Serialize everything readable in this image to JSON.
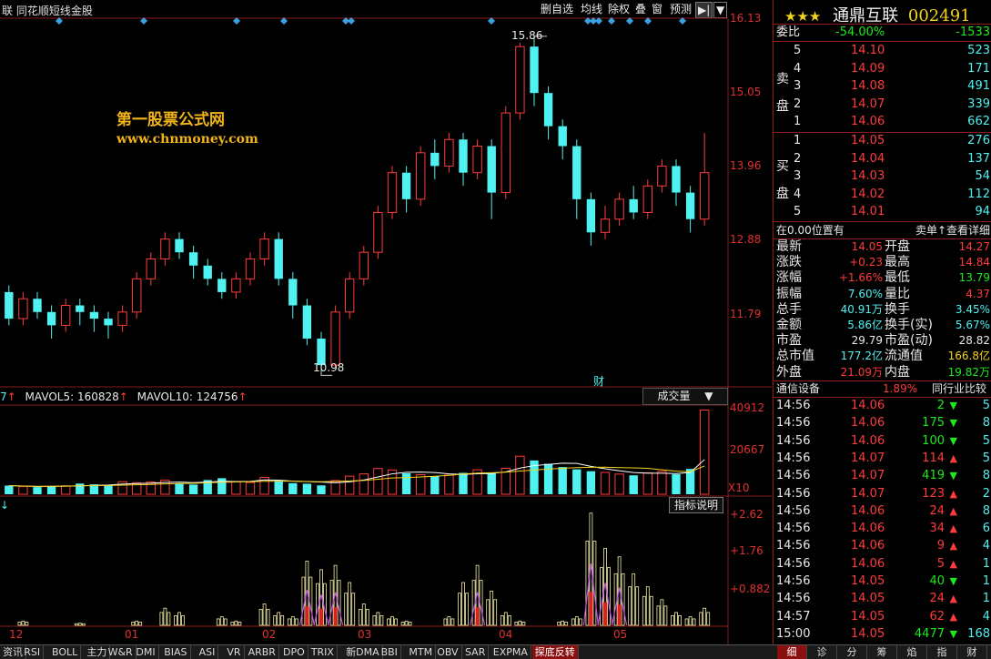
{
  "window": {
    "title": "联 同花顺短线金股"
  },
  "toolbar": {
    "buttons": [
      "删自选",
      "均线",
      "除权",
      "叠",
      "窗",
      "预测"
    ],
    "nav": "▶|",
    "menu": "▼"
  },
  "price_axis": {
    "labels": [
      "16.13",
      "15.05",
      "13.96",
      "12.88",
      "11.79"
    ]
  },
  "annotations": {
    "high": "15.86",
    "low": "10.98",
    "cai": "财"
  },
  "watermark": {
    "line1": "第一股票公式网",
    "line2": "www.chnmoney.com"
  },
  "volume": {
    "prefix": "7",
    "mavol5": "MAVOL5: 160828",
    "mavol10": "MAVOL10: 124756",
    "selector": "成交量",
    "axis": [
      "40912",
      "20667"
    ],
    "unit": "X10"
  },
  "indicator": {
    "button": "指标说明",
    "axis": [
      "+2.62",
      "+1.76",
      "+0.882"
    ]
  },
  "time_axis": {
    "labels": [
      "12",
      "01",
      "02",
      "03",
      "04",
      "05"
    ]
  },
  "chart_data": {
    "type": "candlestick",
    "price": {
      "ylim": [
        10.7,
        16.2
      ],
      "candles": [
        [
          12.1,
          11.7,
          12.2,
          11.6
        ],
        [
          11.7,
          12.0,
          12.1,
          11.6
        ],
        [
          12.0,
          11.8,
          12.1,
          11.7
        ],
        [
          11.8,
          11.6,
          11.9,
          11.4
        ],
        [
          11.6,
          11.9,
          12.0,
          11.5
        ],
        [
          11.9,
          11.8,
          12.0,
          11.6
        ],
        [
          11.8,
          11.7,
          11.9,
          11.5
        ],
        [
          11.7,
          11.6,
          11.8,
          11.4
        ],
        [
          11.6,
          11.8,
          11.9,
          11.5
        ],
        [
          11.8,
          12.3,
          12.4,
          11.7
        ],
        [
          12.3,
          12.6,
          12.7,
          12.2
        ],
        [
          12.6,
          12.9,
          13.0,
          12.5
        ],
        [
          12.9,
          12.7,
          13.0,
          12.6
        ],
        [
          12.7,
          12.5,
          12.8,
          12.3
        ],
        [
          12.5,
          12.3,
          12.6,
          12.2
        ],
        [
          12.3,
          12.1,
          12.4,
          12.0
        ],
        [
          12.1,
          12.3,
          12.4,
          12.0
        ],
        [
          12.3,
          12.6,
          12.7,
          12.2
        ],
        [
          12.6,
          12.9,
          13.0,
          12.5
        ],
        [
          12.9,
          12.3,
          13.0,
          12.2
        ],
        [
          12.3,
          11.9,
          12.4,
          11.7
        ],
        [
          11.9,
          11.4,
          12.0,
          11.3
        ],
        [
          11.4,
          11.0,
          11.5,
          10.9
        ],
        [
          11.0,
          11.8,
          11.9,
          10.98
        ],
        [
          11.8,
          12.3,
          12.4,
          11.7
        ],
        [
          12.3,
          12.7,
          12.8,
          12.2
        ],
        [
          12.7,
          13.3,
          13.4,
          12.6
        ],
        [
          13.3,
          13.9,
          14.0,
          13.2
        ],
        [
          13.9,
          13.5,
          14.0,
          13.3
        ],
        [
          13.5,
          14.2,
          14.3,
          13.4
        ],
        [
          14.2,
          14.0,
          14.4,
          13.8
        ],
        [
          14.0,
          14.4,
          14.5,
          13.9
        ],
        [
          14.4,
          13.9,
          14.5,
          13.7
        ],
        [
          13.9,
          14.3,
          14.4,
          13.8
        ],
        [
          14.3,
          13.6,
          14.4,
          13.2
        ],
        [
          13.6,
          14.8,
          14.9,
          13.5
        ],
        [
          14.8,
          15.8,
          15.86,
          14.7
        ],
        [
          15.8,
          15.1,
          15.9,
          14.9
        ],
        [
          15.1,
          14.6,
          15.2,
          14.4
        ],
        [
          14.6,
          14.3,
          14.7,
          14.1
        ],
        [
          14.3,
          13.5,
          14.4,
          13.2
        ],
        [
          13.5,
          13.0,
          13.6,
          12.8
        ],
        [
          13.0,
          13.2,
          13.4,
          12.9
        ],
        [
          13.2,
          13.5,
          13.6,
          13.1
        ],
        [
          13.5,
          13.3,
          13.7,
          13.2
        ],
        [
          13.3,
          13.7,
          13.8,
          13.2
        ],
        [
          13.7,
          14.0,
          14.1,
          13.6
        ],
        [
          14.0,
          13.6,
          14.1,
          13.4
        ],
        [
          13.6,
          13.2,
          13.7,
          13.0
        ],
        [
          13.2,
          13.9,
          14.5,
          13.1
        ]
      ]
    },
    "volume": {
      "ylim": [
        0,
        42000
      ],
      "values": [
        4200,
        3800,
        3500,
        3900,
        4100,
        5200,
        4800,
        4400,
        6100,
        5600,
        5900,
        6800,
        5200,
        4700,
        6900,
        7800,
        6100,
        5700,
        8200,
        6500,
        5400,
        5100,
        4300,
        6600,
        8800,
        9900,
        12500,
        11800,
        10200,
        9500,
        8700,
        9300,
        10400,
        11900,
        10100,
        12600,
        18500,
        16400,
        14800,
        13200,
        12100,
        11200,
        10600,
        9800,
        9200,
        10400,
        11100,
        9700,
        12300,
        40912
      ]
    },
    "indicator": {
      "ylim": [
        0,
        2.7
      ],
      "values": [
        0,
        0.1,
        0,
        0,
        0,
        0.05,
        0,
        0,
        0,
        0.1,
        0,
        0.4,
        0.3,
        0,
        0,
        0.2,
        0.1,
        0,
        0.5,
        0.3,
        0.2,
        1.5,
        1.3,
        1.4,
        1.0,
        0.5,
        0.3,
        0.2,
        0.1,
        0,
        0,
        0.2,
        1.0,
        1.4,
        0.8,
        0.3,
        0.1,
        0,
        0,
        0.1,
        0.2,
        2.62,
        1.8,
        1.6,
        1.2,
        0.9,
        0.6,
        0.3,
        0.2,
        0.4
      ]
    }
  },
  "stock": {
    "stars": "★★★",
    "name": "通鼎互联",
    "code": "002491"
  },
  "weibi": {
    "label": "委比",
    "pct": "-54.00%",
    "val": "-1533"
  },
  "sell": {
    "side": [
      "卖",
      "盘"
    ],
    "rows": [
      [
        "5",
        "14.10",
        "523"
      ],
      [
        "4",
        "14.09",
        "171"
      ],
      [
        "3",
        "14.08",
        "491"
      ],
      [
        "2",
        "14.07",
        "339"
      ],
      [
        "1",
        "14.06",
        "662"
      ]
    ]
  },
  "buy": {
    "side": [
      "买",
      "盘"
    ],
    "rows": [
      [
        "1",
        "14.05",
        "276"
      ],
      [
        "2",
        "14.04",
        "137"
      ],
      [
        "3",
        "14.03",
        "54"
      ],
      [
        "4",
        "14.02",
        "112"
      ],
      [
        "5",
        "14.01",
        "94"
      ]
    ]
  },
  "info_hdr": {
    "left": "在0.00位置有",
    "right": "卖单↑查看详细"
  },
  "stats": [
    [
      "最新",
      "14.05",
      "开盘",
      "14.27"
    ],
    [
      "涨跌",
      "+0.23",
      "最高",
      "14.84"
    ],
    [
      "涨幅",
      "+1.66%",
      "最低",
      "13.79"
    ],
    [
      "振幅",
      "7.60%",
      "量比",
      "4.37"
    ],
    [
      "总手",
      "40.91万",
      "换手",
      "3.45%"
    ],
    [
      "金额",
      "5.86亿",
      "换手(实)",
      "5.67%"
    ],
    [
      "市盈",
      "29.79",
      "市盈(动)",
      "28.82"
    ],
    [
      "总市值",
      "177.2亿",
      "流通值",
      "166.8亿"
    ],
    [
      "外盘",
      "21.09万",
      "内盘",
      "19.82万"
    ]
  ],
  "industry": {
    "name": "通信设备",
    "pct": "1.89%",
    "btn": "同行业比较"
  },
  "ticks": [
    [
      "14:56",
      "14.06",
      "2",
      "dn",
      "5"
    ],
    [
      "14:56",
      "14.06",
      "175",
      "dn",
      "8"
    ],
    [
      "14:56",
      "14.06",
      "100",
      "dn",
      "5"
    ],
    [
      "14:56",
      "14.07",
      "114",
      "up",
      "5"
    ],
    [
      "14:56",
      "14.07",
      "419",
      "dn",
      "8"
    ],
    [
      "14:56",
      "14.07",
      "123",
      "up",
      "2"
    ],
    [
      "14:56",
      "14.06",
      "24",
      "up",
      "8"
    ],
    [
      "14:56",
      "14.06",
      "34",
      "up",
      "6"
    ],
    [
      "14:56",
      "14.06",
      "9",
      "up",
      "4"
    ],
    [
      "14:56",
      "14.06",
      "5",
      "up",
      "1"
    ],
    [
      "14:56",
      "14.05",
      "40",
      "dn",
      "1"
    ],
    [
      "14:56",
      "14.05",
      "24",
      "up",
      "1"
    ],
    [
      "14:57",
      "14.05",
      "62",
      "up",
      "4"
    ],
    [
      "15:00",
      "14.05",
      "4477",
      "dn",
      "168"
    ]
  ],
  "bottom_tabs": [
    "资讯",
    "RSI",
    "BOLL",
    "主力",
    "W&R",
    "DMI",
    "BIAS",
    "ASI",
    "VR",
    "ARBR",
    "DPO",
    "TRIX",
    "新DMA",
    "BBI",
    "MTM",
    "OBV",
    "SAR",
    "EXPMA",
    "探底反转"
  ],
  "right_tabs": [
    "细",
    "诊",
    "分",
    "筹",
    "焰",
    "指",
    "财"
  ]
}
